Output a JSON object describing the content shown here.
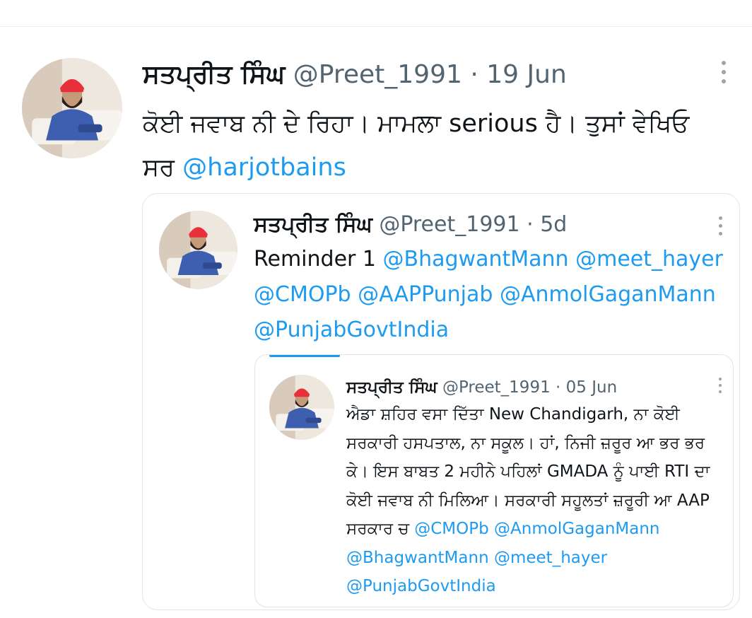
{
  "tweet": {
    "author_name": "ਸਤਪ੍ਰੀਤ ਸਿੰਘ",
    "handle": "@Preet_1991",
    "separator": "·",
    "date": "19 Jun",
    "text_part1": "ਕੋਈ ਜਵਾਬ ਨੀ ਦੇ ਰਿਹਾ। ਮਾਮਲਾ serious ਹੈ। ਤੁਸਾਂ ਵੇਖਿਓ ਸਰ ",
    "mention": "@harjotbains",
    "more_icon": "more-vertical-icon"
  },
  "quote1": {
    "author_name": "ਸਤਪ੍ਰੀਤ ਸਿੰਘ",
    "handle": "@Preet_1991",
    "separator": "·",
    "date": "5d",
    "text_part1": "Reminder 1 ",
    "mentions": [
      "@BhagwantMann",
      "@meet_hayer",
      "@CMOPb",
      "@AAPPunjab",
      "@AnmolGaganMann",
      "@PunjabGovtIndia"
    ],
    "more_icon": "more-vertical-icon"
  },
  "quote2": {
    "author_name": "ਸਤਪ੍ਰੀਤ ਸਿੰਘ",
    "handle": "@Preet_1991",
    "separator": "·",
    "date": "05 Jun",
    "text_part1": "ਐਡਾ ਸ਼ਹਿਰ ਵਸਾ ਦਿੱਤਾ New Chandigarh, ਨਾ ਕੋਈ ਸਰਕਾਰੀ ਹਸਪਤਾਲ, ਨਾ ਸਕੂਲ। ਹਾਂ, ਨਿਜੀ ਜ਼ਰੂਰ ਆ ਭਰ ਭਰ ਕੇ। ਇਸ ਬਾਬਤ 2 ਮਹੀਨੇ ਪਹਿਲਾਂ GMADA ਨੂੰ ਪਾਈ RTI ਦਾ ਕੋਈ ਜਵਾਬ ਨੀ ਮਿਲਿਆ। ਸਰਕਾਰੀ ਸਹੂਲਤਾਂ ਜ਼ਰੂਰੀ ਆ AAP ਸਰਕਾਰ ਚ ",
    "mentions": [
      "@CMOPb",
      "@AnmolGaganMann",
      "@BhagwantMann",
      "@meet_hayer",
      "@PunjabGovtIndia"
    ],
    "more_icon": "more-vertical-icon"
  },
  "colors": {
    "link": "#1d9bf0",
    "meta": "#536471",
    "border": "#dfe4e8",
    "turban": "#e8303a",
    "shirt": "#3e5fb0"
  }
}
